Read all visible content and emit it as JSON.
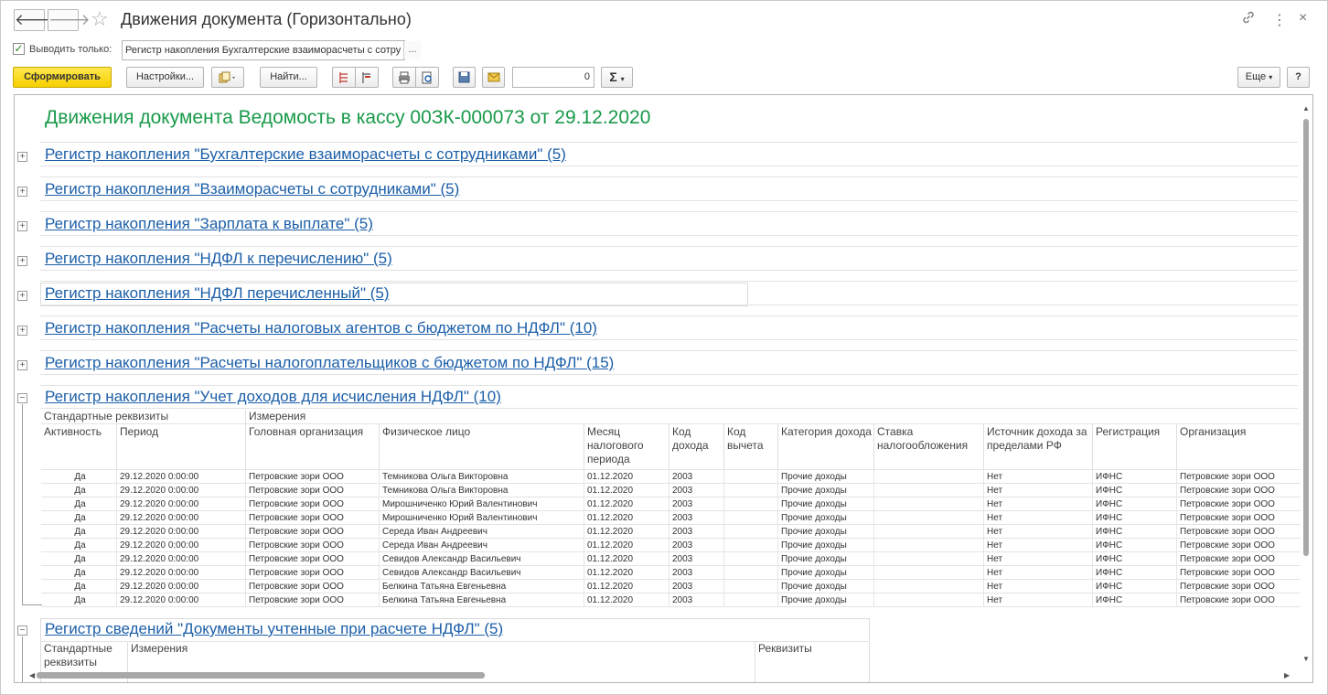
{
  "window": {
    "title": "Движения документа (Горизонтально)",
    "back": "🡐",
    "forward": "🡒",
    "link_icon": "🔗",
    "more_icon": "⋮",
    "close_icon": "×"
  },
  "filter": {
    "label": "Выводить только:",
    "value": "Регистр накопления Бухгалтерские взаиморасчеты с сотру",
    "dots": "..."
  },
  "toolbar": {
    "generate": "Сформировать",
    "settings": "Настройки...",
    "find": "Найти...",
    "number_value": "0",
    "sum": "Σ",
    "more": "Еще",
    "help": "?"
  },
  "report": {
    "title": "Движения документа Ведомость в кассу 00ЗК-000073 от 29.12.2020",
    "registers": [
      {
        "name": "Регистр накопления \"Бухгалтерские взаиморасчеты с сотрудниками\" (5)",
        "expanded": false
      },
      {
        "name": "Регистр накопления \"Взаиморасчеты с сотрудниками\" (5)",
        "expanded": false
      },
      {
        "name": "Регистр накопления \"Зарплата к выплате\" (5)",
        "expanded": false
      },
      {
        "name": "Регистр накопления \"НДФЛ к перечислению\" (5)",
        "expanded": false
      },
      {
        "name": "Регистр накопления \"НДФЛ перечисленный\" (5)",
        "expanded": false
      },
      {
        "name": "Регистр накопления \"Расчеты налоговых агентов с бюджетом по НДФЛ\" (10)",
        "expanded": false
      },
      {
        "name": "Регистр накопления \"Расчеты налогоплательщиков с бюджетом по НДФЛ\" (15)",
        "expanded": false
      },
      {
        "name": "Регистр накопления \"Учет доходов для исчисления НДФЛ\" (10)",
        "expanded": true
      }
    ],
    "group_headers": {
      "standard": "Стандартные реквизиты",
      "dimensions": "Измерения"
    },
    "columns": [
      "Активность",
      "Период",
      "Головная организация",
      "Физическое лицо",
      "Месяц налогового периода",
      "Код дохода",
      "Код вычета",
      "Категория дохода",
      "Ставка налогообложения",
      "Источник дохода за пределами РФ",
      "Регистрация",
      "Организация"
    ],
    "rows": [
      [
        "Да",
        "29.12.2020 0:00:00",
        "Петровские зори ООО",
        "Темникова Ольга Викторовна",
        "01.12.2020",
        "2003",
        "",
        "Прочие доходы",
        "",
        "Нет",
        "ИФНС",
        "Петровские зори ООО"
      ],
      [
        "Да",
        "29.12.2020 0:00:00",
        "Петровские зори ООО",
        "Темникова Ольга Викторовна",
        "01.12.2020",
        "2003",
        "",
        "Прочие доходы",
        "",
        "Нет",
        "ИФНС",
        "Петровские зори ООО"
      ],
      [
        "Да",
        "29.12.2020 0:00:00",
        "Петровские зори ООО",
        "Мирошниченко Юрий Валентинович",
        "01.12.2020",
        "2003",
        "",
        "Прочие доходы",
        "",
        "Нет",
        "ИФНС",
        "Петровские зори ООО"
      ],
      [
        "Да",
        "29.12.2020 0:00:00",
        "Петровские зори ООО",
        "Мирошниченко Юрий Валентинович",
        "01.12.2020",
        "2003",
        "",
        "Прочие доходы",
        "",
        "Нет",
        "ИФНС",
        "Петровские зори ООО"
      ],
      [
        "Да",
        "29.12.2020 0:00:00",
        "Петровские зори ООО",
        "Середа Иван Андреевич",
        "01.12.2020",
        "2003",
        "",
        "Прочие доходы",
        "",
        "Нет",
        "ИФНС",
        "Петровские зори ООО"
      ],
      [
        "Да",
        "29.12.2020 0:00:00",
        "Петровские зори ООО",
        "Середа Иван Андреевич",
        "01.12.2020",
        "2003",
        "",
        "Прочие доходы",
        "",
        "Нет",
        "ИФНС",
        "Петровские зори ООО"
      ],
      [
        "Да",
        "29.12.2020 0:00:00",
        "Петровские зори ООО",
        "Севидов Александр Васильевич",
        "01.12.2020",
        "2003",
        "",
        "Прочие доходы",
        "",
        "Нет",
        "ИФНС",
        "Петровские зори ООО"
      ],
      [
        "Да",
        "29.12.2020 0:00:00",
        "Петровские зори ООО",
        "Севидов Александр Васильевич",
        "01.12.2020",
        "2003",
        "",
        "Прочие доходы",
        "",
        "Нет",
        "ИФНС",
        "Петровские зори ООО"
      ],
      [
        "Да",
        "29.12.2020 0:00:00",
        "Петровские зори ООО",
        "Белкина Татьяна Евгеньевна",
        "01.12.2020",
        "2003",
        "",
        "Прочие доходы",
        "",
        "Нет",
        "ИФНС",
        "Петровские зори ООО"
      ],
      [
        "Да",
        "29.12.2020 0:00:00",
        "Петровские зори ООО",
        "Белкина Татьяна Евгеньевна",
        "01.12.2020",
        "2003",
        "",
        "Прочие доходы",
        "",
        "Нет",
        "ИФНС",
        "Петровские зори ООО"
      ]
    ],
    "info_register": {
      "name": "Регистр сведений \"Документы учтенные при расчете НДФЛ\" (5)",
      "headers": [
        "Стандартные реквизиты",
        "Измерения",
        "Реквизиты"
      ]
    }
  },
  "colors": {
    "title_green": "#199a4a",
    "link_blue": "#1c5fa8",
    "primary_yellow": "#f6cf00"
  }
}
